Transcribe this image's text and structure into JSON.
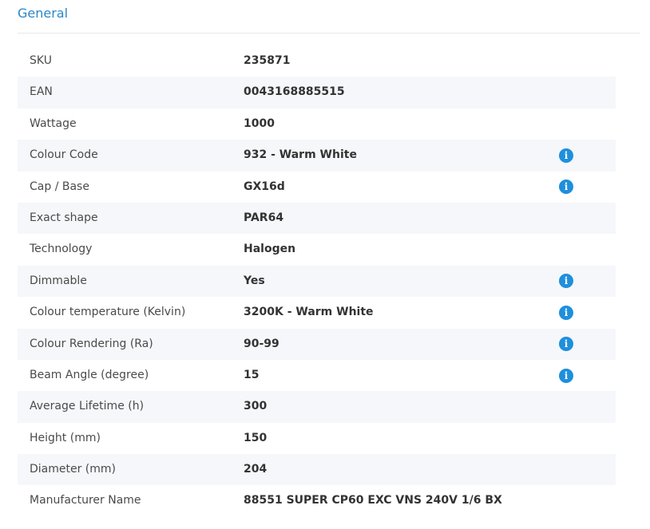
{
  "section": {
    "title": "General"
  },
  "info_icon_glyph": "i",
  "specs": [
    {
      "label": "SKU",
      "value": "235871",
      "has_info": false
    },
    {
      "label": "EAN",
      "value": "0043168885515",
      "has_info": false
    },
    {
      "label": "Wattage",
      "value": "1000",
      "has_info": false
    },
    {
      "label": "Colour Code",
      "value": "932 - Warm White",
      "has_info": true
    },
    {
      "label": "Cap / Base",
      "value": "GX16d",
      "has_info": true
    },
    {
      "label": "Exact shape",
      "value": "PAR64",
      "has_info": false
    },
    {
      "label": "Technology",
      "value": "Halogen",
      "has_info": false
    },
    {
      "label": "Dimmable",
      "value": "Yes",
      "has_info": true
    },
    {
      "label": "Colour temperature (Kelvin)",
      "value": "3200K - Warm White",
      "has_info": true
    },
    {
      "label": "Colour Rendering (Ra)",
      "value": "90-99",
      "has_info": true
    },
    {
      "label": "Beam Angle (degree)",
      "value": "15",
      "has_info": true
    },
    {
      "label": "Average Lifetime (h)",
      "value": "300",
      "has_info": false
    },
    {
      "label": "Height (mm)",
      "value": "150",
      "has_info": false
    },
    {
      "label": "Diameter (mm)",
      "value": "204",
      "has_info": false
    },
    {
      "label": "Manufacturer Name",
      "value": "88551 SUPER CP60 EXC VNS 240V 1/6 BX",
      "has_info": false
    }
  ],
  "colors": {
    "accent": "#2a86c8",
    "info_icon": "#1f8fdc",
    "row_alt": "#f5f7fa"
  }
}
